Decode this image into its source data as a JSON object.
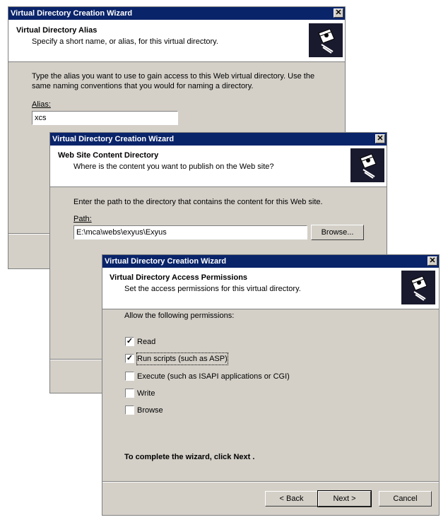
{
  "wizard1": {
    "title": "Virtual Directory Creation Wizard",
    "header_title": "Virtual Directory Alias",
    "header_subtitle": "Specify a short name, or alias, for this virtual directory.",
    "instructions_line1": "Type the alias you want to use to gain access to this Web virtual directory. Use the",
    "instructions_line2": "same naming conventions that you would for naming a directory.",
    "alias_label": "Alias:",
    "alias_value": "xcs"
  },
  "wizard2": {
    "title": "Virtual Directory Creation Wizard",
    "header_title": "Web Site Content Directory",
    "header_subtitle": "Where is the content you want to publish on the Web site?",
    "instructions": "Enter the path to the directory that contains the content for this Web site.",
    "path_label": "Path:",
    "path_value": "E:\\mca\\webs\\exyus\\Exyus",
    "browse_label": "Browse..."
  },
  "wizard3": {
    "title": "Virtual Directory Creation Wizard",
    "header_title": "Virtual Directory Access Permissions",
    "header_subtitle": "Set the access permissions for this virtual directory.",
    "allow_label": "Allow the following permissions:",
    "permissions": [
      {
        "label": "Read",
        "checked": true
      },
      {
        "label": "Run scripts (such as ASP)",
        "checked": true
      },
      {
        "label": "Execute (such as ISAPI applications or CGI)",
        "checked": false
      },
      {
        "label": "Write",
        "checked": false
      },
      {
        "label": "Browse",
        "checked": false
      }
    ],
    "complete_text": "To complete the wizard, click Next .",
    "back_label": "< Back",
    "next_label": "Next >",
    "cancel_label": "Cancel"
  },
  "icons": {
    "close": "close-icon",
    "wizard": "wizard-icon",
    "check": "checkmark-icon"
  },
  "colors": {
    "titlebar": "#0a246a",
    "dialog": "#d4d0c8",
    "header": "#ffffff"
  }
}
